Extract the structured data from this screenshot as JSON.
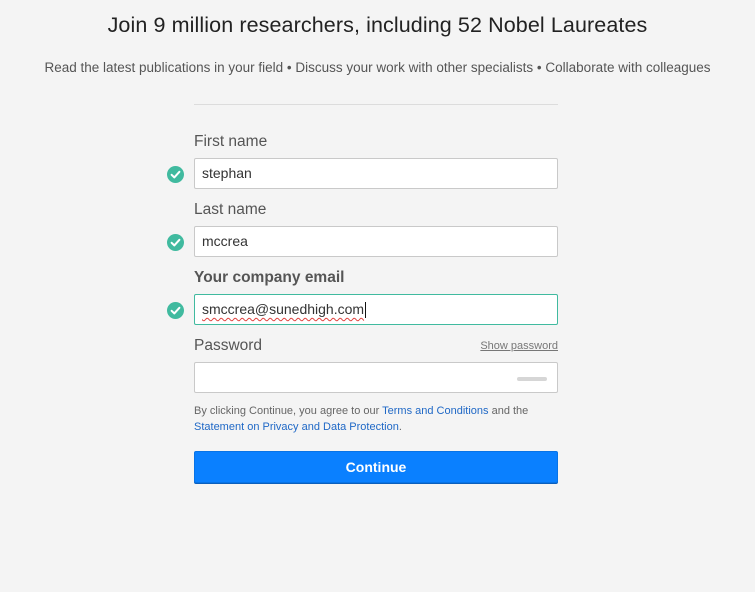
{
  "header": {
    "title": "Join 9 million researchers, including 52 Nobel Laureates",
    "subtitle": "Read the latest publications in your field • Discuss your work with other specialists • Collaborate with colleagues"
  },
  "form": {
    "first_name": {
      "label": "First name",
      "value": "stephan",
      "valid": true
    },
    "last_name": {
      "label": "Last name",
      "value": "mccrea",
      "valid": true
    },
    "email": {
      "label": "Your company email",
      "value": "smccrea@sunedhigh.com",
      "valid": true,
      "focused": true
    },
    "password": {
      "label": "Password",
      "value": "",
      "show_password_link": "Show password"
    },
    "terms": {
      "prefix": "By clicking Continue, you agree to our ",
      "terms_link": "Terms and Conditions",
      "middle": " and the",
      "privacy_link": "Statement on Privacy and Data Protection",
      "suffix": "."
    },
    "continue_label": "Continue"
  },
  "icons": {
    "valid_check": "check-circle-icon"
  },
  "colors": {
    "accent_green": "#40ba9f",
    "primary_button": "#0a80ff",
    "link": "#1f68c6",
    "background": "#f4f4f4"
  }
}
